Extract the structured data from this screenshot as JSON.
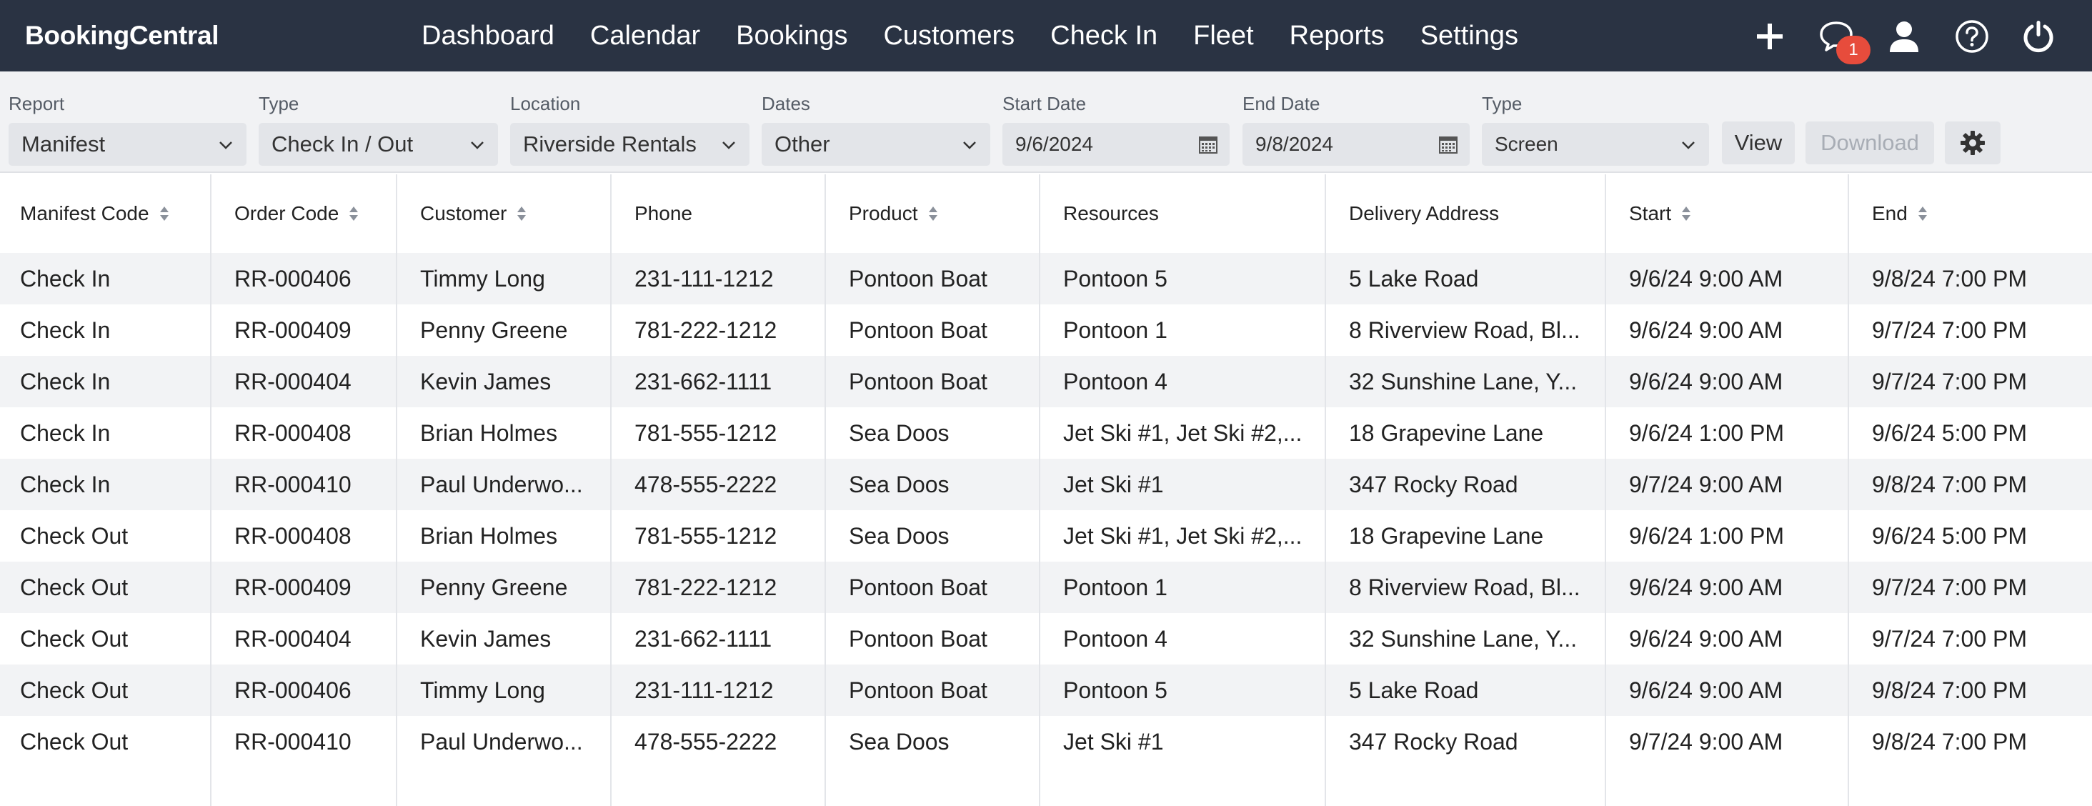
{
  "navbar": {
    "brand": "BookingCentral",
    "links": [
      "Dashboard",
      "Calendar",
      "Bookings",
      "Customers",
      "Check In",
      "Fleet",
      "Reports",
      "Settings"
    ],
    "icons": [
      "plus-icon",
      "chat-icon",
      "user-icon",
      "help-icon",
      "power-icon"
    ],
    "chat_badge": "1"
  },
  "filters": {
    "report": {
      "label": "Report",
      "value": "Manifest"
    },
    "type": {
      "label": "Type",
      "value": "Check In / Out"
    },
    "location": {
      "label": "Location",
      "value": "Riverside Rentals"
    },
    "dates": {
      "label": "Dates",
      "value": "Other"
    },
    "start_date": {
      "label": "Start Date",
      "value": "9/6/2024"
    },
    "end_date": {
      "label": "End Date",
      "value": "9/8/2024"
    },
    "output_type": {
      "label": "Type",
      "value": "Screen"
    },
    "view_label": "View",
    "download_label": "Download"
  },
  "table": {
    "headers": [
      "Manifest Code",
      "Order Code",
      "Customer",
      "Phone",
      "Product",
      "Resources",
      "Delivery Address",
      "Start",
      "End"
    ],
    "rows": [
      [
        "Check In",
        "RR-000406",
        "Timmy Long",
        "231-111-1212",
        "Pontoon Boat",
        "Pontoon 5",
        "5 Lake Road",
        "9/6/24 9:00 AM",
        "9/8/24 7:00 PM"
      ],
      [
        "Check In",
        "RR-000409",
        "Penny Greene",
        "781-222-1212",
        "Pontoon Boat",
        "Pontoon 1",
        "8 Riverview Road, Bl...",
        "9/6/24 9:00 AM",
        "9/7/24 7:00 PM"
      ],
      [
        "Check In",
        "RR-000404",
        "Kevin James",
        "231-662-1111",
        "Pontoon Boat",
        "Pontoon 4",
        "32 Sunshine Lane, Y...",
        "9/6/24 9:00 AM",
        "9/7/24 7:00 PM"
      ],
      [
        "Check In",
        "RR-000408",
        "Brian Holmes",
        "781-555-1212",
        "Sea Doos",
        "Jet Ski #1, Jet Ski #2,...",
        "18 Grapevine Lane",
        "9/6/24 1:00 PM",
        "9/6/24 5:00 PM"
      ],
      [
        "Check In",
        "RR-000410",
        "Paul Underwo...",
        "478-555-2222",
        "Sea Doos",
        "Jet Ski #1",
        "347 Rocky Road",
        "9/7/24 9:00 AM",
        "9/8/24 7:00 PM"
      ],
      [
        "Check Out",
        "RR-000408",
        "Brian Holmes",
        "781-555-1212",
        "Sea Doos",
        "Jet Ski #1, Jet Ski #2,...",
        "18 Grapevine Lane",
        "9/6/24 1:00 PM",
        "9/6/24 5:00 PM"
      ],
      [
        "Check Out",
        "RR-000409",
        "Penny Greene",
        "781-222-1212",
        "Pontoon Boat",
        "Pontoon 1",
        "8 Riverview Road, Bl...",
        "9/6/24 9:00 AM",
        "9/7/24 7:00 PM"
      ],
      [
        "Check Out",
        "RR-000404",
        "Kevin James",
        "231-662-1111",
        "Pontoon Boat",
        "Pontoon 4",
        "32 Sunshine Lane, Y...",
        "9/6/24 9:00 AM",
        "9/7/24 7:00 PM"
      ],
      [
        "Check Out",
        "RR-000406",
        "Timmy Long",
        "231-111-1212",
        "Pontoon Boat",
        "Pontoon 5",
        "5 Lake Road",
        "9/6/24 9:00 AM",
        "9/8/24 7:00 PM"
      ],
      [
        "Check Out",
        "RR-000410",
        "Paul Underwo...",
        "478-555-2222",
        "Sea Doos",
        "Jet Ski #1",
        "347 Rocky Road",
        "9/7/24 9:00 AM",
        "9/8/24 7:00 PM"
      ]
    ]
  },
  "colors": {
    "navbar_bg": "#2a3343",
    "badge": "#e74c3c",
    "filter_bg": "#f1f2f4",
    "row_stripe": "#f2f3f5"
  }
}
